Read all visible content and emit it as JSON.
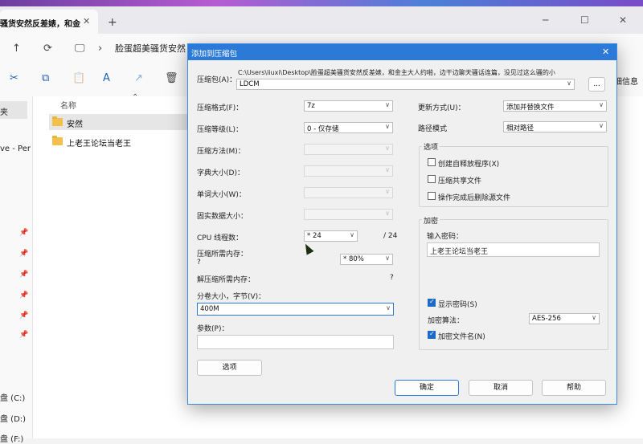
{
  "window": {
    "tab_title": "骚货安然反差婊，和金",
    "tab_close": "✕",
    "new_tab": "+",
    "minimize": "─",
    "maximize": "☐",
    "close": "✕"
  },
  "address": {
    "back": "←",
    "forward": "→",
    "up": "↑",
    "refresh": "⟳",
    "monitor": "🖵",
    "separator": "›",
    "breadcrumb": "脸蛋超美骚货安然"
  },
  "toolbar": {
    "cut": "✂",
    "copy": "⧉",
    "paste": "📋",
    "rename": "A",
    "share": "↗",
    "delete": "🗑",
    "right_label": "细信息"
  },
  "sidebar": {
    "selected_label": "夹",
    "item_label": "ve - Per",
    "drive_c": "盘 (C:)",
    "drive_d": "盘 (D:)",
    "drive_f": "盘 (F:)",
    "pin": "📌"
  },
  "files": {
    "column_name": "名称",
    "sort_arrow": "⌃",
    "items": [
      "安然",
      "上老王论坛当老王"
    ]
  },
  "dialog": {
    "title": "添加到压缩包",
    "close": "✕",
    "archive_label": "压缩包(A)：",
    "archive_path": "C:\\Users\\liuxi\\Desktop\\脸蛋超美骚货安然反差婊，和金主大人约啪，边干边聊天骚话连篇，没见过这么骚的小",
    "archive_name": "LDCM",
    "browse": "...",
    "format_label": "压缩格式(F)：",
    "format_value": "7z",
    "level_label": "压缩等级(L)：",
    "level_value": "0 - 仅存储",
    "method_label": "压缩方法(M)：",
    "dict_label": "字典大小(D)：",
    "word_label": "单词大小(W)：",
    "solid_label": "固实数据大小：",
    "cpu_label": "CPU 线程数：",
    "cpu_value": "* 24",
    "cpu_total": "/ 24",
    "mem_label": "压缩所需内存：",
    "mem_q": "?",
    "mem_value": "* 80%",
    "decomp_label": "解压缩所需内存：",
    "decomp_q": "?",
    "split_label": "分卷大小，字节(V)：",
    "split_value": "400M",
    "params_label": "参数(P)：",
    "options_btn": "选项",
    "update_label": "更新方式(U)：",
    "update_value": "添加并替换文件",
    "path_label": "路径模式",
    "path_value": "相对路径",
    "options_group": "选项",
    "opt_sfx": "创建自释放程序(X)",
    "opt_shared": "压缩共享文件",
    "opt_delete": "操作完成后删除源文件",
    "enc_group": "加密",
    "enc_pwd_label": "输入密码：",
    "enc_pwd_value": "上老王论坛当老王",
    "show_pwd": "显示密码(S)",
    "enc_method_label": "加密算法：",
    "enc_method_value": "AES-256",
    "enc_names": "加密文件名(N)",
    "ok": "确定",
    "cancel": "取消",
    "help": "帮助",
    "checkmark": "✓",
    "chevron": "∨"
  }
}
